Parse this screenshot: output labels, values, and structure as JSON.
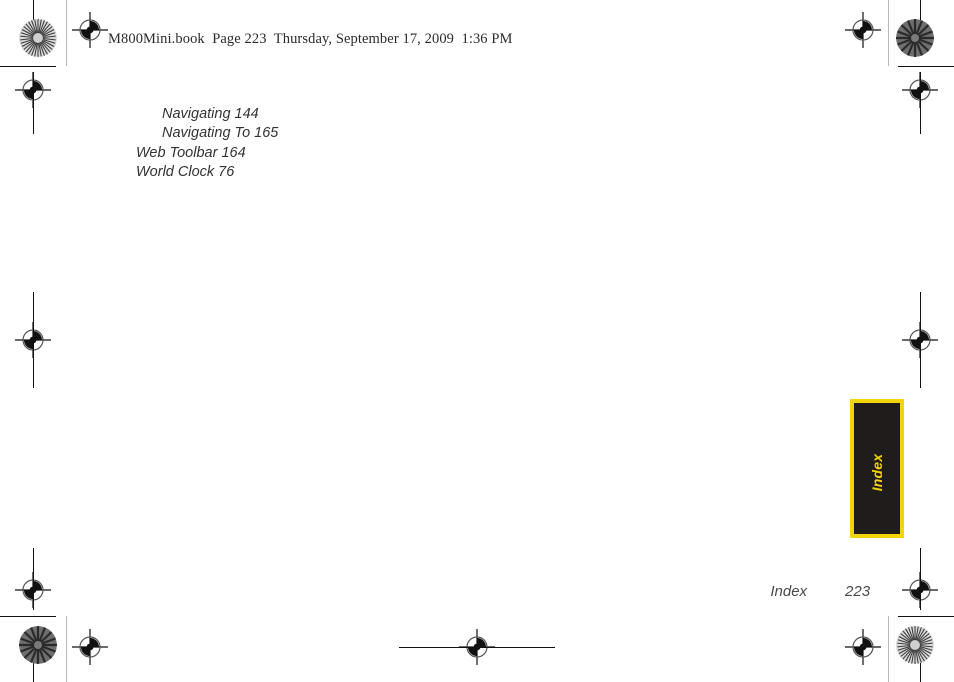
{
  "document": {
    "header_line": "M800Mini.book  Page 223  Thursday, September 17, 2009  1:36 PM",
    "book_file": "M800Mini.book",
    "page_label": "Page 223",
    "date": "Thursday, September 17, 2009",
    "time": "1:36 PM"
  },
  "index": {
    "entries": [
      {
        "text": "Navigating 144",
        "level": 1
      },
      {
        "text": "Navigating To 165",
        "level": 2
      },
      {
        "text": "Web Toolbar 164",
        "level": 0
      },
      {
        "text": "World Clock 76",
        "level": 0
      }
    ]
  },
  "side_tab": {
    "label": "Index",
    "background_color": "#1f1c1b",
    "border_color": "#f2d407",
    "text_color": "#f2d407"
  },
  "footer": {
    "section": "Index",
    "page_number": "223",
    "text_color": "#4a4a4a"
  },
  "print_marks": {
    "registration_icon": "registration-target-icon",
    "star_icon": "star-target-icon",
    "crop_line_color": "#111111",
    "guide_line_color": "#b9b9b9"
  }
}
